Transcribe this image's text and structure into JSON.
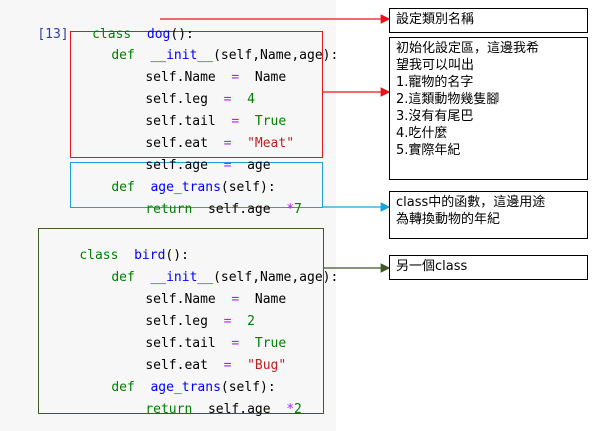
{
  "cell": {
    "prompt": "[13]"
  },
  "code": {
    "line1": {
      "kw": "class",
      "name": "dog",
      "rest": "():"
    },
    "dog_init": {
      "kw": "def",
      "name": "__init__",
      "rest": "(self,Name,age):"
    },
    "dog_name": {
      "lhs": "self.Name",
      "op": "=",
      "rhs": "Name"
    },
    "dog_leg": {
      "lhs": "self.leg",
      "op": "=",
      "rhs": "4"
    },
    "dog_tail": {
      "lhs": "self.tail",
      "op": "=",
      "rhs": "True"
    },
    "dog_eat": {
      "lhs": "self.eat",
      "op": "=",
      "rhs": "\"Meat\""
    },
    "dog_age": {
      "lhs": "self.age",
      "op": "=",
      "rhs": "age"
    },
    "dog_trans_def": {
      "kw": "def",
      "name": "age_trans",
      "rest": "(self):"
    },
    "dog_trans_ret": {
      "kw": "return",
      "expr": "self.age",
      "op": "*",
      "num": "7"
    },
    "bird_class": {
      "kw": "class",
      "name": "bird",
      "rest": "():"
    },
    "bird_init": {
      "kw": "def",
      "name": "__init__",
      "rest": "(self,Name,age):"
    },
    "bird_name": {
      "lhs": "self.Name",
      "op": "=",
      "rhs": "Name"
    },
    "bird_leg": {
      "lhs": "self.leg",
      "op": "=",
      "rhs": "2"
    },
    "bird_tail": {
      "lhs": "self.tail",
      "op": "=",
      "rhs": "True"
    },
    "bird_eat": {
      "lhs": "self.eat",
      "op": "=",
      "rhs": "\"Bug\""
    },
    "bird_trans_def": {
      "kw": "def",
      "name": "age_trans",
      "rest": "(self):"
    },
    "bird_trans_ret": {
      "kw": "return",
      "expr": "self.age",
      "op": "*",
      "num": "2"
    }
  },
  "notes": {
    "class_name": "設定類別名稱",
    "init_lines": [
      "初始化設定區，這邊我希",
      "望我可以叫出",
      "1.寵物的名字",
      "2.這類動物幾隻腳",
      "3.沒有有尾巴",
      "4.吃什麼",
      "5.實際年紀"
    ],
    "function_lines": [
      "class中的函數，這邊用途",
      "為轉換動物的年紀"
    ],
    "another_class": "另一個class"
  },
  "colors": {
    "red_box": "#e8141c",
    "blue_box": "#1aa3d6",
    "green_box": "#3f5a2a",
    "red_arrow": "#e8141c",
    "blue_arrow": "#1aa3d6",
    "green_arrow": "#3f5a2a"
  }
}
